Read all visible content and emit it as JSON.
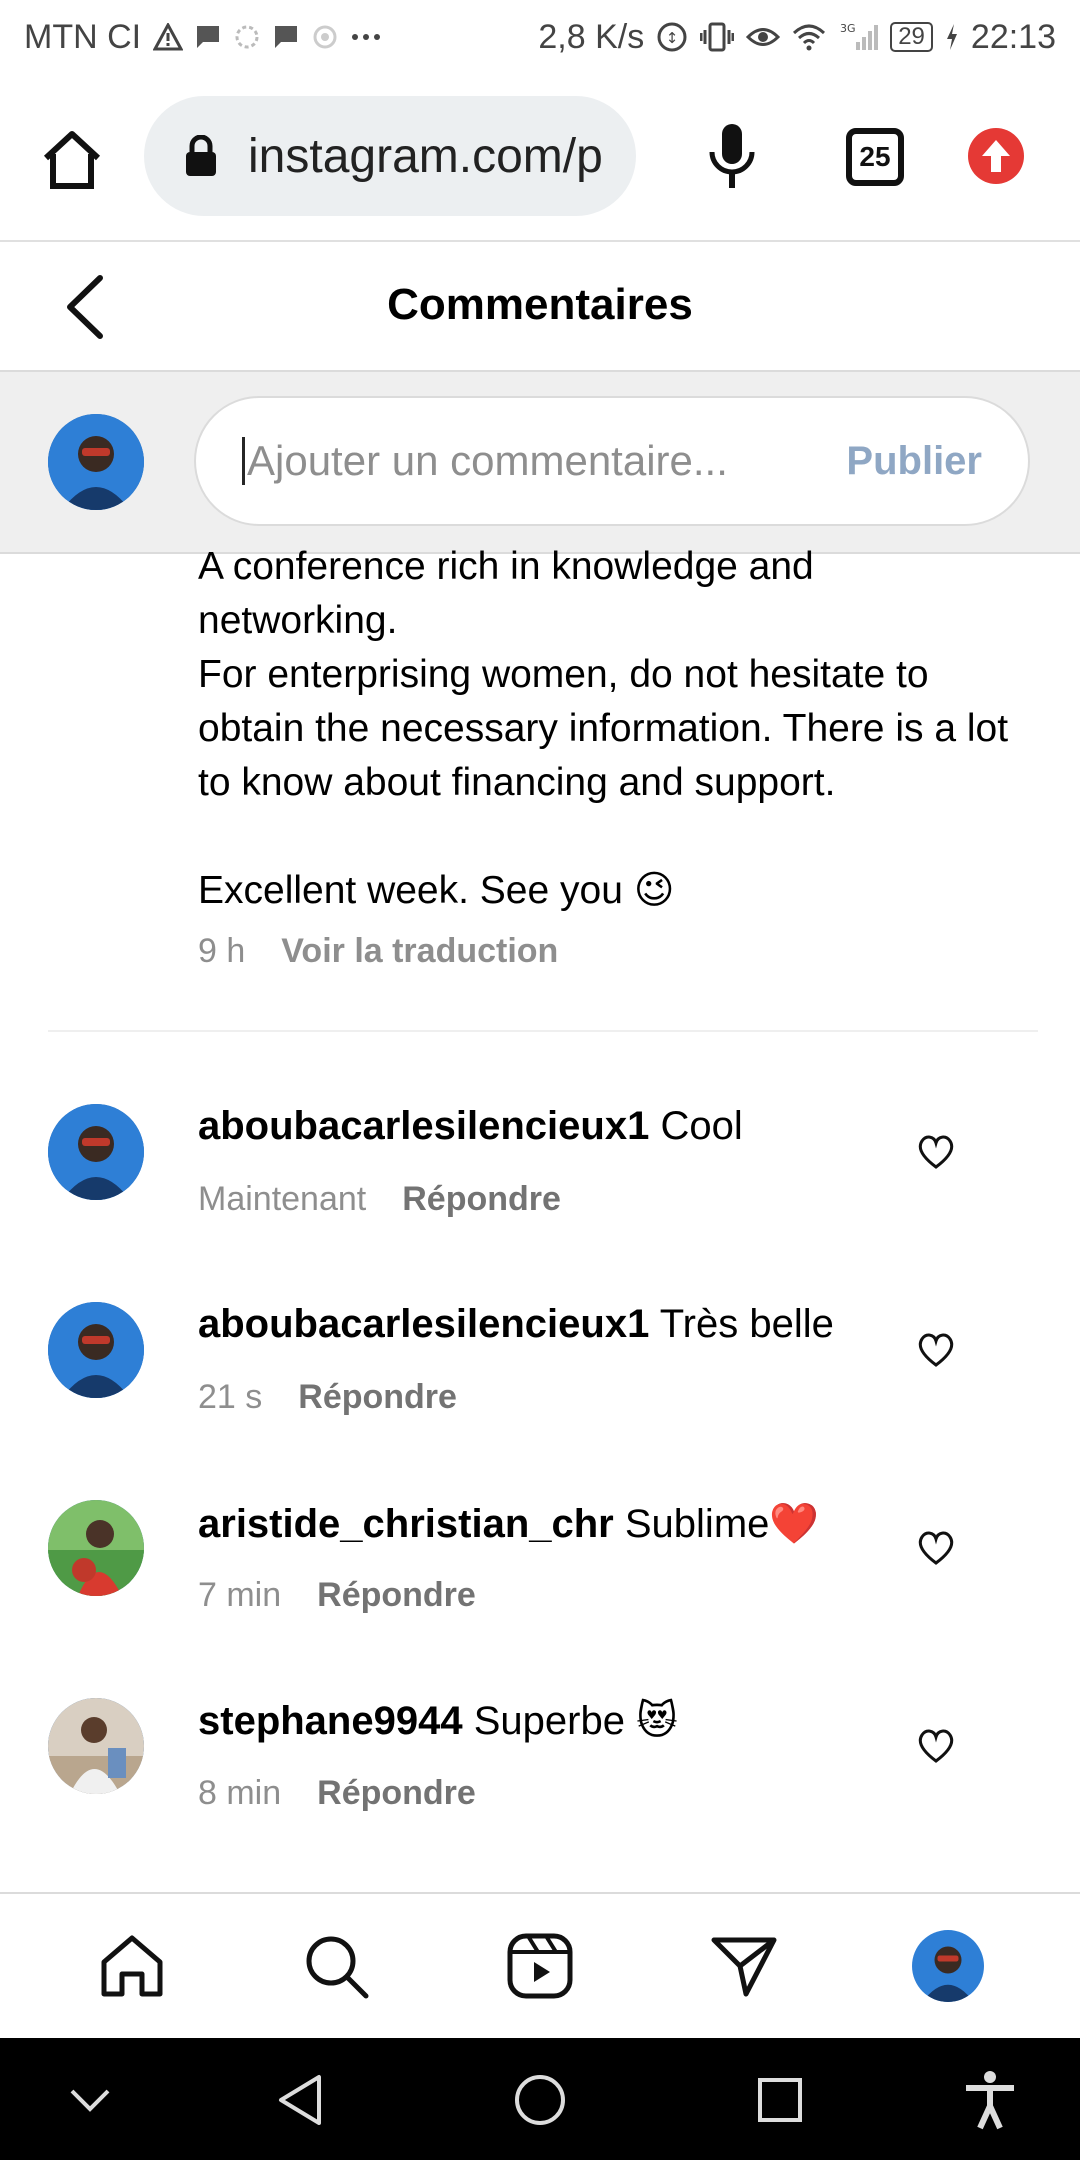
{
  "status_bar": {
    "carrier": "MTN CI",
    "speed": "2,8 K/s",
    "network": "3G",
    "battery": "29",
    "time": "22:13",
    "icons": [
      "warning-icon",
      "message-icon",
      "sync-icon",
      "message-icon",
      "settings-icon",
      "more-icon",
      "data-saver-icon",
      "vibrate-icon",
      "eye-icon",
      "wifi-icon",
      "signal-icon",
      "charging-icon"
    ]
  },
  "browser": {
    "url": "instagram.com/p",
    "tab_count": "25",
    "accent_update": "#e53935"
  },
  "header": {
    "title": "Commentaires"
  },
  "composer": {
    "placeholder": "Ajouter un commentaire...",
    "publish_label": "Publier",
    "publish_color": "#8fa7c4"
  },
  "caption": {
    "text": "A conference rich in knowledge and networking.\nFor enterprising women, do not hesitate to obtain the necessary information. There is a lot to know about financing and support.\n\nExcellent week. See you 😉",
    "time": "9 h",
    "translate_label": "Voir la traduction"
  },
  "comments": [
    {
      "user": "aboubacarlesilencieux1",
      "text": "Cool",
      "time": "Maintenant",
      "reply_label": "Répondre",
      "avatar": "avatar-blue"
    },
    {
      "user": "aboubacarlesilencieux1",
      "text": "Très belle",
      "time": "21 s",
      "reply_label": "Répondre",
      "avatar": "avatar-blue"
    },
    {
      "user": "aristide_christian_chr",
      "text": "Sublime❤️",
      "time": "7 min",
      "reply_label": "Répondre",
      "avatar": "avatar-green"
    },
    {
      "user": "stephane9944",
      "text": "Superbe 😻",
      "time": "8 min",
      "reply_label": "Répondre",
      "avatar": "avatar-beige"
    }
  ],
  "bottom_nav": [
    "home-icon",
    "search-icon",
    "reels-icon",
    "direct-icon",
    "profile-avatar"
  ],
  "system_nav": [
    "collapse-icon",
    "back-icon",
    "home-circle-icon",
    "recents-icon",
    "accessibility-icon"
  ]
}
